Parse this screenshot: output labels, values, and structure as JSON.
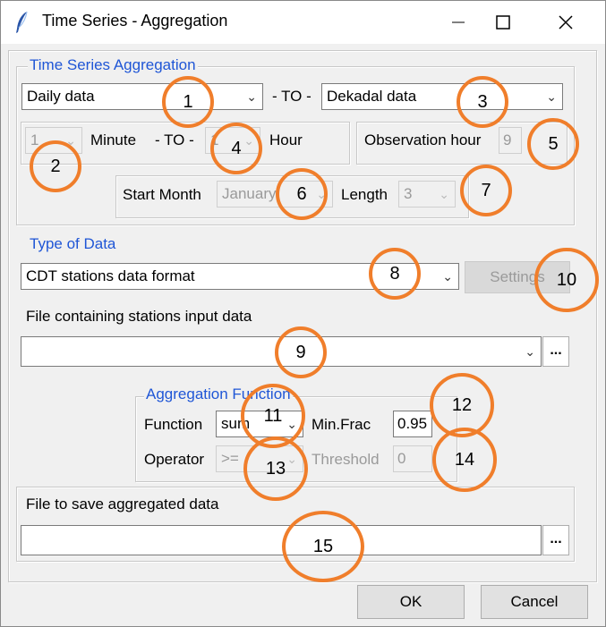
{
  "window": {
    "title": "Time Series - Aggregation"
  },
  "aggregation": {
    "legend": "Time Series Aggregation",
    "from_value": "Daily data",
    "to_label": "- TO -",
    "to_value": "Dekadal data",
    "minute_from": "1",
    "minute_label": "Minute",
    "minute_to_label": "- TO -",
    "hour_to": "1",
    "hour_label": "Hour",
    "obs_hour_label": "Observation hour",
    "obs_hour_value": "9",
    "start_month_label": "Start Month",
    "start_month_value": "January",
    "length_label": "Length",
    "length_value": "3"
  },
  "data_type": {
    "legend": "Type of Data",
    "format_value": "CDT stations data format",
    "settings_label": "Settings",
    "input_file_label": "File containing stations input data",
    "input_file_value": "",
    "browse_label": "..."
  },
  "function": {
    "legend": "Aggregation Function",
    "function_label": "Function",
    "function_value": "sum",
    "minfrac_label": "Min.Frac",
    "minfrac_value": "0.95",
    "operator_label": "Operator",
    "operator_value": ">=",
    "threshold_label": "Threshold",
    "threshold_value": "0"
  },
  "output": {
    "label": "File to save aggregated data",
    "value": "",
    "browse_label": "..."
  },
  "buttons": {
    "ok": "OK",
    "cancel": "Cancel"
  },
  "markers": [
    "1",
    "2",
    "3",
    "4",
    "5",
    "6",
    "7",
    "8",
    "9",
    "10",
    "11",
    "12",
    "13",
    "14",
    "15"
  ],
  "colors": {
    "legend": "#1f56d6",
    "marker": "#f07e2b"
  }
}
